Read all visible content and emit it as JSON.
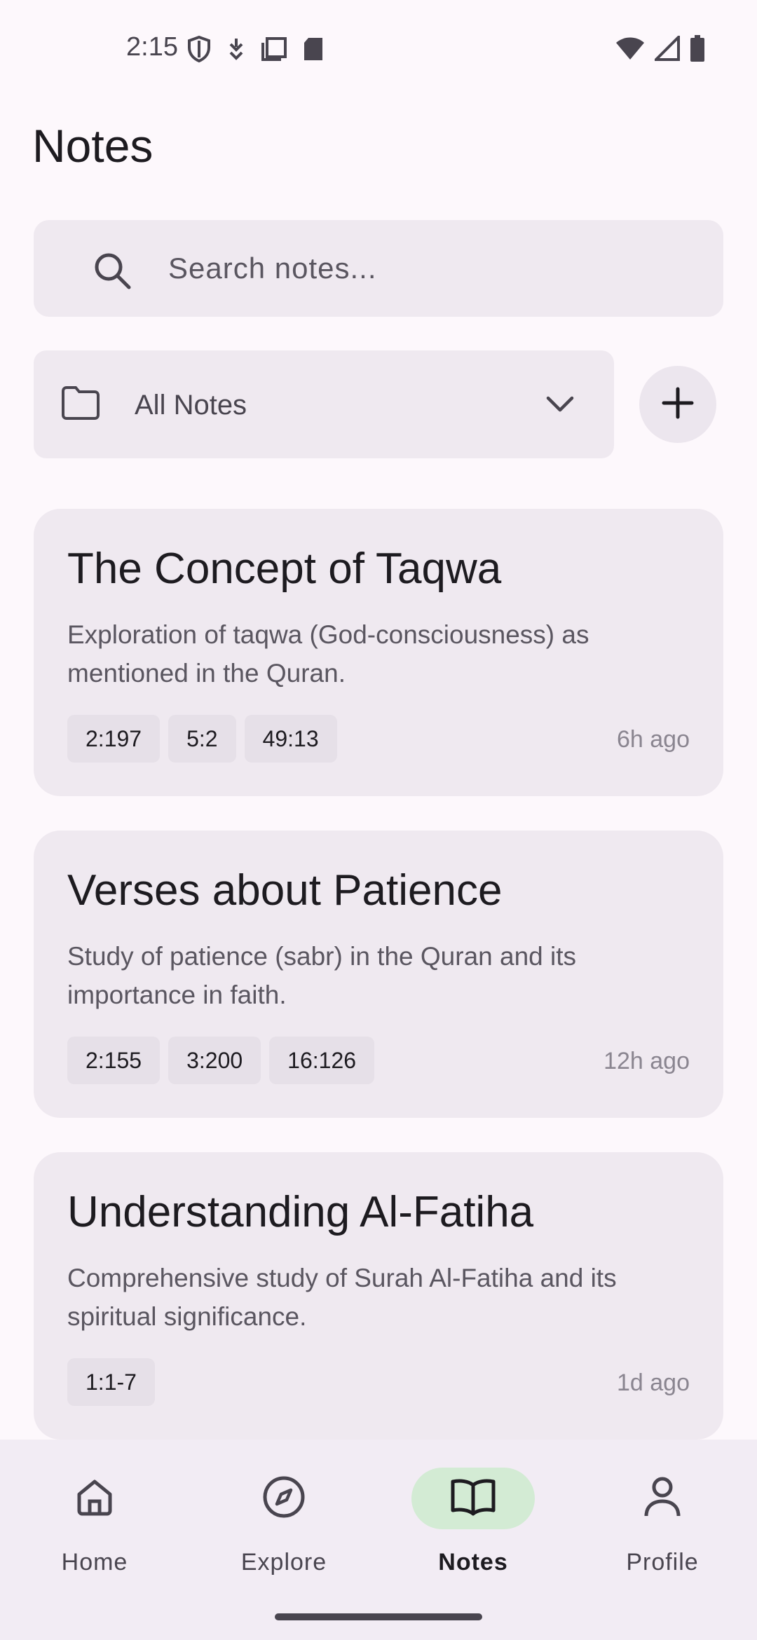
{
  "status_bar": {
    "time": "2:15",
    "left_icons": [
      "shield-icon",
      "download-arrow-icon",
      "copy-icon",
      "sd-card-icon"
    ],
    "right_icons": [
      "wifi-icon",
      "cell-signal-icon",
      "battery-icon"
    ]
  },
  "page": {
    "title": "Notes"
  },
  "search": {
    "placeholder": "Search notes..."
  },
  "folder": {
    "selected": "All Notes"
  },
  "notes": [
    {
      "title": "The Concept of Taqwa",
      "description": "Exploration of taqwa (God-consciousness) as mentioned in the Quran.",
      "tags": [
        "2:197",
        "5:2",
        "49:13"
      ],
      "time": "6h ago"
    },
    {
      "title": "Verses about Patience",
      "description": "Study of patience (sabr) in the Quran and its importance in faith.",
      "tags": [
        "2:155",
        "3:200",
        "16:126"
      ],
      "time": "12h ago"
    },
    {
      "title": "Understanding Al-Fatiha",
      "description": "Comprehensive study of Surah Al-Fatiha and its spiritual significance.",
      "tags": [
        "1:1-7"
      ],
      "time": "1d ago"
    }
  ],
  "bottom_nav": {
    "items": [
      {
        "label": "Home",
        "icon": "home-icon",
        "active": false
      },
      {
        "label": "Explore",
        "icon": "compass-icon",
        "active": false
      },
      {
        "label": "Notes",
        "icon": "book-icon",
        "active": true
      },
      {
        "label": "Profile",
        "icon": "person-icon",
        "active": false
      }
    ]
  },
  "colors": {
    "background": "#fdf8fc",
    "surface": "#efe9f0",
    "active_pill": "#d3ebd4",
    "text_primary": "#1d1b20",
    "text_secondary": "#49454f"
  }
}
